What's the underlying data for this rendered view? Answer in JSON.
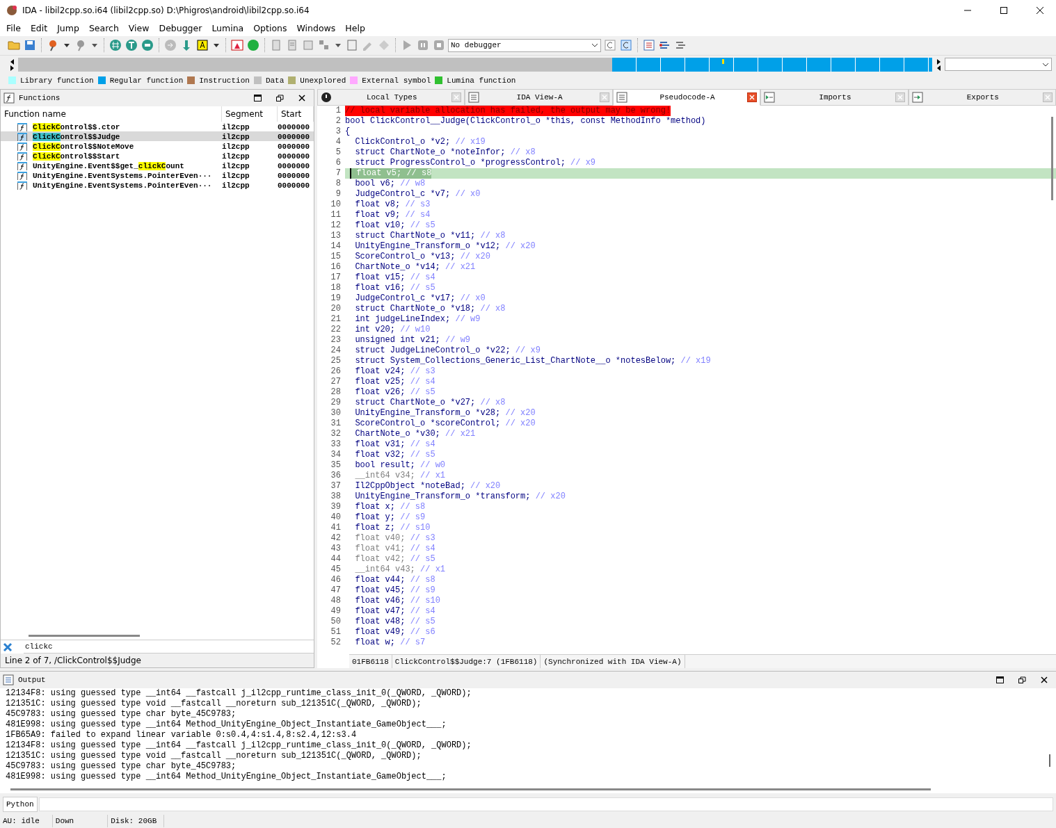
{
  "window": {
    "title": "IDA - libil2cpp.so.i64 (libil2cpp.so) D:\\Phigros\\android\\libil2cpp.so.i64"
  },
  "menu": [
    "File",
    "Edit",
    "Jump",
    "Search",
    "View",
    "Debugger",
    "Lumina",
    "Options",
    "Windows",
    "Help"
  ],
  "toolbar": {
    "debugger": "No debugger"
  },
  "legend": [
    {
      "label": "Library function",
      "color": "#aaffff"
    },
    {
      "label": "Regular function",
      "color": "#00a0e8"
    },
    {
      "label": "Instruction",
      "color": "#b07850"
    },
    {
      "label": "Data",
      "color": "#c0c0c0"
    },
    {
      "label": "Unexplored",
      "color": "#b0b070"
    },
    {
      "label": "External symbol",
      "color": "#ffa8ff"
    },
    {
      "label": "Lumina function",
      "color": "#30c030"
    }
  ],
  "functions": {
    "title": "Functions",
    "columns": [
      "Function name",
      "Segment",
      "Start"
    ],
    "rows": [
      {
        "name": [
          {
            "text": "ClickC",
            "highlighted": true
          },
          {
            "text": "ontrol$$.ctor",
            "highlighted": false
          }
        ],
        "segment": "il2cpp",
        "start": "0000000",
        "selected": false
      },
      {
        "name": [
          {
            "text": "ClickC",
            "highlighted": true
          },
          {
            "text": "ontrol$$Judge",
            "highlighted": false
          }
        ],
        "segment": "il2cpp",
        "start": "0000000",
        "selected": true
      },
      {
        "name": [
          {
            "text": "ClickC",
            "highlighted": true
          },
          {
            "text": "ontrol$$NoteMove",
            "highlighted": false
          }
        ],
        "segment": "il2cpp",
        "start": "0000000",
        "selected": false
      },
      {
        "name": [
          {
            "text": "ClickC",
            "highlighted": true
          },
          {
            "text": "ontrol$$Start",
            "highlighted": false
          }
        ],
        "segment": "il2cpp",
        "start": "0000000",
        "selected": false
      },
      {
        "name": [
          {
            "text": "UnityEngine.Event$$get_",
            "highlighted": false
          },
          {
            "text": "clickC",
            "highlighted": true
          },
          {
            "text": "ount",
            "highlighted": false
          }
        ],
        "segment": "il2cpp",
        "start": "0000000",
        "selected": false
      },
      {
        "name": [
          {
            "text": "UnityEngine.EventSystems.PointerEven···",
            "highlighted": false
          }
        ],
        "segment": "il2cpp",
        "start": "0000000",
        "selected": false
      },
      {
        "name": [
          {
            "text": "UnityEngine.EventSystems.PointerEven···",
            "highlighted": false
          }
        ],
        "segment": "il2cpp",
        "start": "0000000",
        "selected": false
      }
    ],
    "filter": "clickc",
    "status": "Line 2 of 7, /ClickControl$$Judge"
  },
  "tabs": [
    {
      "label": "Local Types",
      "selected": false
    },
    {
      "label": "IDA View-A",
      "selected": false
    },
    {
      "label": "Pseudocode-A",
      "selected": true
    },
    {
      "label": "Imports",
      "selected": false
    },
    {
      "label": "Exports",
      "selected": false
    }
  ],
  "pseudocode": {
    "lines": [
      {
        "num": "1",
        "kind": "warning",
        "code": "// local variable allocation has failed, the output may be wrong!",
        "selected": false
      },
      {
        "num": "2",
        "kind": "code",
        "code": "bool ClickControl__Judge(ClickControl_o *this, const MethodInfo *method)",
        "selected": false
      },
      {
        "num": "3",
        "kind": "code",
        "code": "{",
        "selected": false
      },
      {
        "num": "4",
        "kind": "code",
        "code": "  ClickControl_o *v2;",
        "comment": "// x19",
        "selected": false
      },
      {
        "num": "5",
        "kind": "code",
        "code": "  struct ChartNote_o *noteInfor;",
        "comment": "// x8",
        "selected": false
      },
      {
        "num": "6",
        "kind": "code",
        "code": "  struct ProgressControl_o *progressControl;",
        "comment": "// x9",
        "selected": false
      },
      {
        "num": "7",
        "kind": "code",
        "code": "  float v5;",
        "comment": "// s8",
        "selected": true
      },
      {
        "num": "8",
        "kind": "code",
        "code": "  bool v6;",
        "comment": "// w8",
        "selected": false
      },
      {
        "num": "9",
        "kind": "code",
        "code": "  JudgeControl_c *v7;",
        "comment": "// x0",
        "selected": false
      },
      {
        "num": "10",
        "kind": "code",
        "code": "  float v8;",
        "comment": "// s3",
        "selected": false
      },
      {
        "num": "11",
        "kind": "code",
        "code": "  float v9;",
        "comment": "// s4",
        "selected": false
      },
      {
        "num": "12",
        "kind": "code",
        "code": "  float v10;",
        "comment": "// s5",
        "selected": false
      },
      {
        "num": "13",
        "kind": "code",
        "code": "  struct ChartNote_o *v11;",
        "comment": "// x8",
        "selected": false
      },
      {
        "num": "14",
        "kind": "code",
        "code": "  UnityEngine_Transform_o *v12;",
        "comment": "// x20",
        "selected": false
      },
      {
        "num": "15",
        "kind": "code",
        "code": "  ScoreControl_o *v13;",
        "comment": "// x20",
        "selected": false
      },
      {
        "num": "16",
        "kind": "code",
        "code": "  ChartNote_o *v14;",
        "comment": "// x21",
        "selected": false
      },
      {
        "num": "17",
        "kind": "code",
        "code": "  float v15;",
        "comment": "// s4",
        "selected": false
      },
      {
        "num": "18",
        "kind": "code",
        "code": "  float v16;",
        "comment": "// s5",
        "selected": false
      },
      {
        "num": "19",
        "kind": "code",
        "code": "  JudgeControl_c *v17;",
        "comment": "// x0",
        "selected": false
      },
      {
        "num": "20",
        "kind": "code",
        "code": "  struct ChartNote_o *v18;",
        "comment": "// x8",
        "selected": false
      },
      {
        "num": "21",
        "kind": "code",
        "code": "  int judgeLineIndex;",
        "comment": "// w9",
        "selected": false
      },
      {
        "num": "22",
        "kind": "code",
        "code": "  int v20;",
        "comment": "// w10",
        "selected": false
      },
      {
        "num": "23",
        "kind": "code",
        "code": "  unsigned int v21;",
        "comment": "// w9",
        "selected": false
      },
      {
        "num": "24",
        "kind": "code",
        "code": "  struct JudgeLineControl_o *v22;",
        "comment": "// x9",
        "selected": false
      },
      {
        "num": "25",
        "kind": "code",
        "code": "  struct System_Collections_Generic_List_ChartNote__o *notesBelow;",
        "comment": "// x19",
        "selected": false
      },
      {
        "num": "26",
        "kind": "code",
        "code": "  float v24;",
        "comment": "// s3",
        "selected": false
      },
      {
        "num": "27",
        "kind": "code",
        "code": "  float v25;",
        "comment": "// s4",
        "selected": false
      },
      {
        "num": "28",
        "kind": "code",
        "code": "  float v26;",
        "comment": "// s5",
        "selected": false
      },
      {
        "num": "29",
        "kind": "code",
        "code": "  struct ChartNote_o *v27;",
        "comment": "// x8",
        "selected": false
      },
      {
        "num": "30",
        "kind": "code",
        "code": "  UnityEngine_Transform_o *v28;",
        "comment": "// x20",
        "selected": false
      },
      {
        "num": "31",
        "kind": "code",
        "code": "  ScoreControl_o *scoreControl;",
        "comment": "// x20",
        "selected": false
      },
      {
        "num": "32",
        "kind": "code",
        "code": "  ChartNote_o *v30;",
        "comment": "// x21",
        "selected": false
      },
      {
        "num": "33",
        "kind": "code",
        "code": "  float v31;",
        "comment": "// s4",
        "selected": false
      },
      {
        "num": "34",
        "kind": "code",
        "code": "  float v32;",
        "comment": "// s5",
        "selected": false
      },
      {
        "num": "35",
        "kind": "code",
        "code": "  bool result;",
        "comment": "// w0",
        "selected": false
      },
      {
        "num": "36",
        "kind": "dimmed",
        "code": "  __int64 v34;",
        "comment": "// x1",
        "selected": false
      },
      {
        "num": "37",
        "kind": "code",
        "code": "  Il2CppObject *noteBad;",
        "comment": "// x20",
        "selected": false
      },
      {
        "num": "38",
        "kind": "code",
        "code": "  UnityEngine_Transform_o *transform;",
        "comment": "// x20",
        "selected": false
      },
      {
        "num": "39",
        "kind": "code",
        "code": "  float x;",
        "comment": "// s8",
        "selected": false
      },
      {
        "num": "40",
        "kind": "code",
        "code": "  float y;",
        "comment": "// s9",
        "selected": false
      },
      {
        "num": "41",
        "kind": "code",
        "code": "  float z;",
        "comment": "// s10",
        "selected": false
      },
      {
        "num": "42",
        "kind": "dimmed",
        "code": "  float v40;",
        "comment": "// s3",
        "selected": false
      },
      {
        "num": "43",
        "kind": "dimmed",
        "code": "  float v41;",
        "comment": "// s4",
        "selected": false
      },
      {
        "num": "44",
        "kind": "dimmed",
        "code": "  float v42;",
        "comment": "// s5",
        "selected": false
      },
      {
        "num": "45",
        "kind": "dimmed",
        "code": "  __int64 v43;",
        "comment": "// x1",
        "selected": false
      },
      {
        "num": "46",
        "kind": "code",
        "code": "  float v44;",
        "comment": "// s8",
        "selected": false
      },
      {
        "num": "47",
        "kind": "code",
        "code": "  float v45;",
        "comment": "// s9",
        "selected": false
      },
      {
        "num": "48",
        "kind": "code",
        "code": "  float v46;",
        "comment": "// s10",
        "selected": false
      },
      {
        "num": "49",
        "kind": "code",
        "code": "  float v47;",
        "comment": "// s4",
        "selected": false
      },
      {
        "num": "50",
        "kind": "code",
        "code": "  float v48;",
        "comment": "// s5",
        "selected": false
      },
      {
        "num": "51",
        "kind": "code",
        "code": "  float v49;",
        "comment": "// s6",
        "selected": false
      },
      {
        "num": "52",
        "kind": "code",
        "code": "  float w;",
        "comment": "// s7",
        "selected": false
      }
    ],
    "status": [
      "01FB6118",
      "ClickControl$$Judge:7 (1FB6118)",
      "(Synchronized with IDA View-A)"
    ]
  },
  "output": {
    "title": "Output",
    "lines": [
      "12134F8: using guessed type __int64 __fastcall j_il2cpp_runtime_class_init_0(_QWORD, _QWORD);",
      "121351C: using guessed type void __fastcall __noreturn sub_121351C(_QWORD, _QWORD);",
      "45C9783: using guessed type char byte_45C9783;",
      "481E998: using guessed type __int64 Method_UnityEngine_Object_Instantiate_GameObject___;",
      "1FB65A9: failed to expand linear variable 0:s0.4,4:s1.4,8:s2.4,12:s3.4",
      "12134F8: using guessed type __int64 __fastcall j_il2cpp_runtime_class_init_0(_QWORD, _QWORD);",
      "121351C: using guessed type void __fastcall __noreturn sub_121351C(_QWORD, _QWORD);",
      "45C9783: using guessed type char byte_45C9783;",
      "481E998: using guessed type __int64 Method_UnityEngine_Object_Instantiate_GameObject___;"
    ],
    "language": "Python"
  },
  "status_bar": [
    "AU:  idle",
    "Down",
    "Disk: 20GB"
  ]
}
